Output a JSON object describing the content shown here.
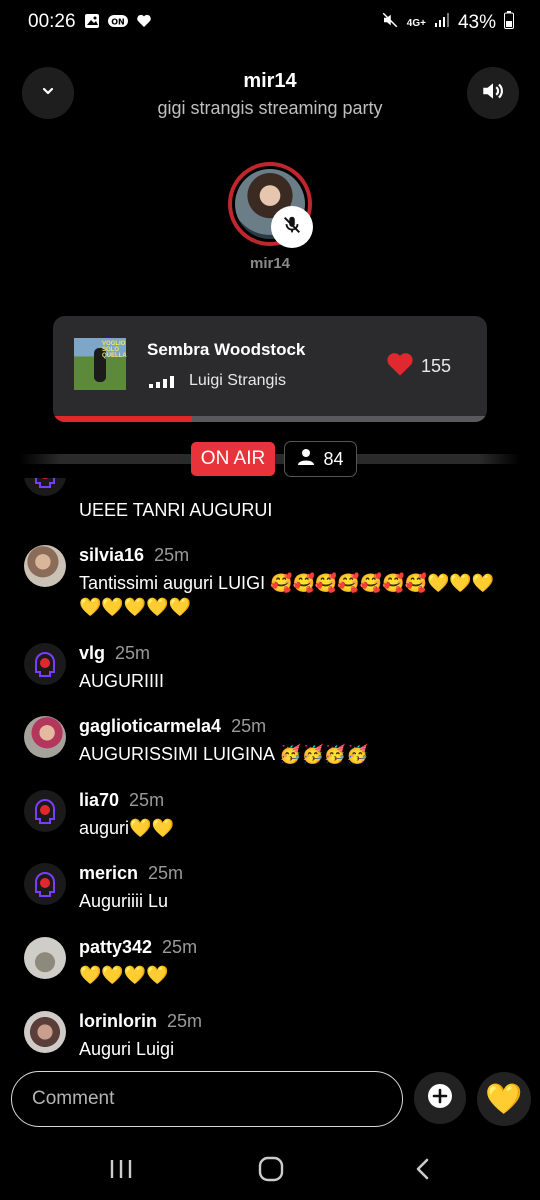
{
  "status": {
    "time": "00:26",
    "battery": "43%",
    "network": "4G+",
    "left_icons": [
      "image-icon",
      "on-badge-icon",
      "heart-icon"
    ],
    "right_icons": [
      "mute-icon",
      "signal-icon",
      "battery-icon"
    ]
  },
  "header": {
    "title": "mir14",
    "subtitle": "gigi strangis streaming party"
  },
  "host": {
    "name": "mir14",
    "muted": true
  },
  "now_playing": {
    "title": "Sembra Woodstock",
    "artist": "Luigi Strangis",
    "likes": "155",
    "progress": 0.32,
    "art_text": "VOGLIO SOLO QUELLA"
  },
  "live": {
    "on_air": "ON AIR",
    "viewers": "84"
  },
  "chat": [
    {
      "user": "",
      "time": "",
      "text": "UEEE TANRI AUGURUI",
      "avatar": "logo"
    },
    {
      "user": "silvia16",
      "time": "25m",
      "text": "Tantissimi auguri LUIGI 🥰🥰🥰🥰🥰🥰🥰💛💛💛💛💛💛💛💛",
      "avatar": "photo1"
    },
    {
      "user": "vlg",
      "time": "25m",
      "text": "AUGURIIII",
      "avatar": "logo"
    },
    {
      "user": "gaglioticarmela4",
      "time": "25m",
      "text": "AUGURISSIMI LUIGINA 🥳🥳🥳🥳",
      "avatar": "photo2"
    },
    {
      "user": "lia70",
      "time": "25m",
      "text": "auguri💛💛",
      "avatar": "logo"
    },
    {
      "user": "mericn",
      "time": "25m",
      "text": "Auguriiii Lu",
      "avatar": "logo"
    },
    {
      "user": "patty342",
      "time": "25m",
      "text": "💛💛💛💛",
      "avatar": "photo3"
    },
    {
      "user": "lorinlorin",
      "time": "25m",
      "text": "Auguri Luigi",
      "avatar": "photo4"
    }
  ],
  "composer": {
    "placeholder": "Comment",
    "reaction": "💛"
  },
  "colors": {
    "accent_red": "#e9333a",
    "card_bg": "#2b2b2e",
    "background": "#000000"
  }
}
